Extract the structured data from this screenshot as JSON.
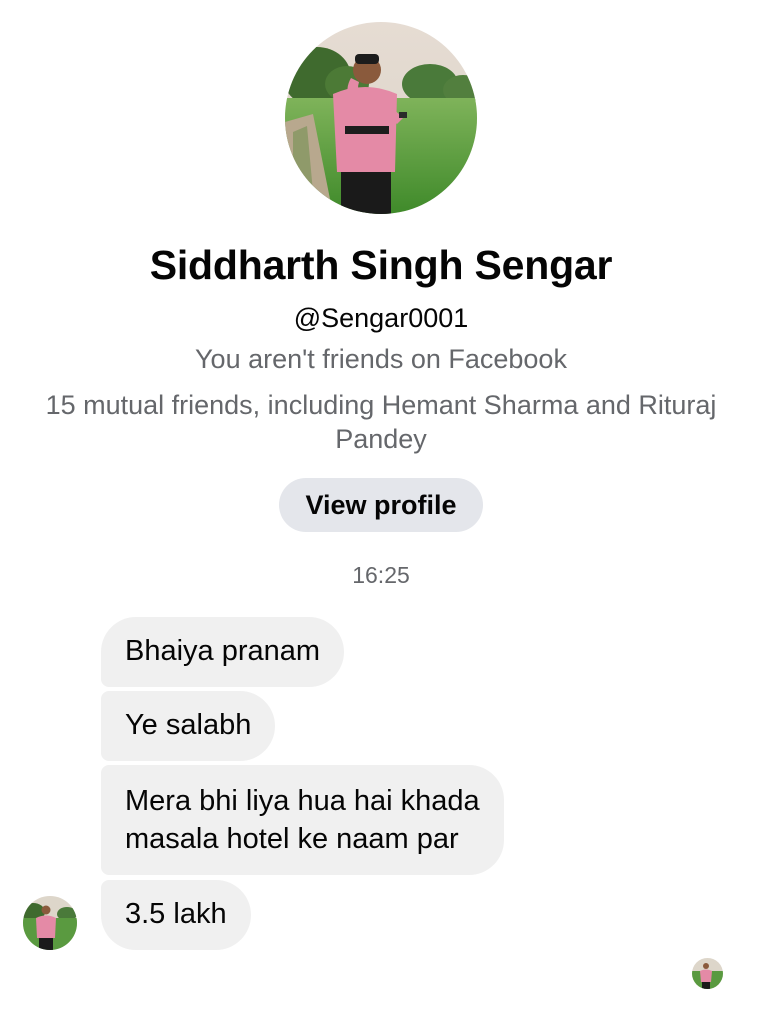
{
  "profile": {
    "name": "Siddharth Singh Sengar",
    "username": "@Sengar0001",
    "friend_status": "You aren't friends on Facebook",
    "mutual_friends": "15 mutual friends, including Hemant Sharma and Rituraj Pandey",
    "view_profile_label": "View profile",
    "avatar_icon": "profile-photo-man-in-field"
  },
  "conversation": {
    "timestamp": "16:25",
    "messages": [
      {
        "text": "Bhaiya pranam"
      },
      {
        "text": "Ye salabh"
      },
      {
        "text": "Mera bhi liya hua hai khada masala hotel ke naam par"
      },
      {
        "text": "3.5 lakh"
      }
    ]
  },
  "colors": {
    "bubble_bg": "#f0f0f0",
    "button_bg": "#e4e6eb",
    "secondary_text": "#65676b",
    "primary_text": "#050505"
  }
}
